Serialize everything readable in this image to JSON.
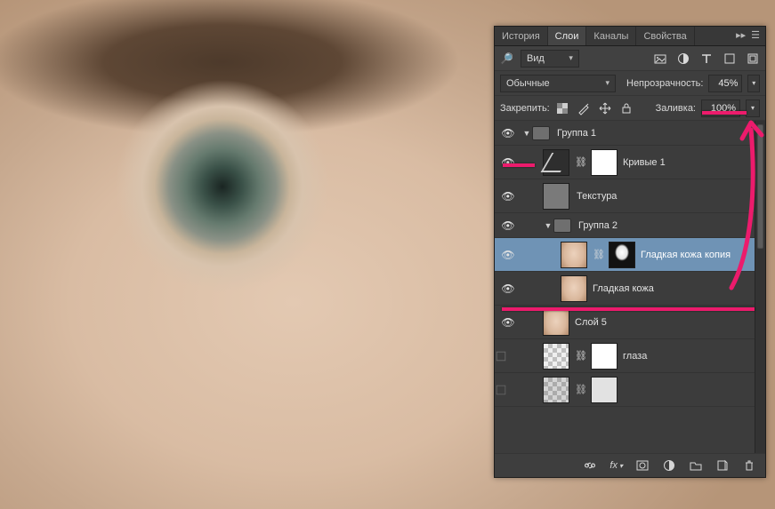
{
  "tabs": {
    "history": "История",
    "layers": "Слои",
    "channels": "Каналы",
    "properties": "Свойства"
  },
  "filter_select": "Вид",
  "blend_mode": "Обычные",
  "opacity_label": "Непрозрачность:",
  "opacity_value": "45%",
  "lock_label": "Закрепить:",
  "fill_label": "Заливка:",
  "fill_value": "100%",
  "layers_list": {
    "group1": {
      "name": "Группа 1"
    },
    "curves1": {
      "name": "Кривые 1"
    },
    "texture": {
      "name": "Текстура"
    },
    "group2": {
      "name": "Группа 2"
    },
    "smooth_copy": {
      "name": "Гладкая кожа копия"
    },
    "smooth": {
      "name": "Гладкая кожа"
    },
    "layer5": {
      "name": "Слой 5"
    },
    "eyes": {
      "name": "глаза"
    }
  },
  "bottom": {
    "fx": "fx"
  },
  "colors": {
    "selected": "#6f93b5",
    "annotation": "#ec1b6c"
  }
}
